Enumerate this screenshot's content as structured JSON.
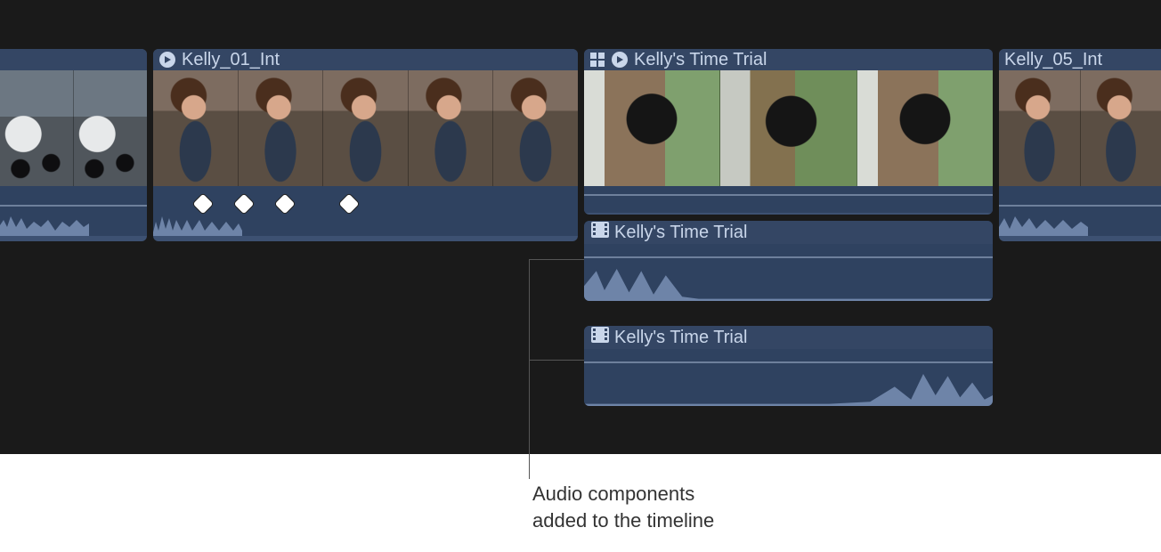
{
  "timeline": {
    "clips": [
      {
        "title": "",
        "thumbs": [
          "car",
          "car"
        ],
        "keyframes": 0
      },
      {
        "title": "Kelly_01_Int",
        "thumbs": [
          "interview",
          "interview",
          "interview",
          "interview",
          "interview"
        ],
        "keyframes": 4
      },
      {
        "title": "Kelly's Time Trial",
        "thumbs": [
          "helmet",
          "helmet2",
          "helmet"
        ],
        "keyframes": 0,
        "compound": true
      },
      {
        "title": "Kelly_05_Int",
        "thumbs": [
          "interview",
          "interview"
        ],
        "keyframes": 0
      }
    ],
    "audio_components": [
      {
        "title": "Kelly's Time Trial"
      },
      {
        "title": "Kelly's Time Trial"
      }
    ]
  },
  "callout": {
    "line1": "Audio components",
    "line2": "added to the timeline"
  },
  "colors": {
    "clip_bg": "#3d5172",
    "clip_header": "#344664",
    "text": "#c9d6ea",
    "wave": "#6e84a8",
    "panel": "#1a1a1a"
  }
}
